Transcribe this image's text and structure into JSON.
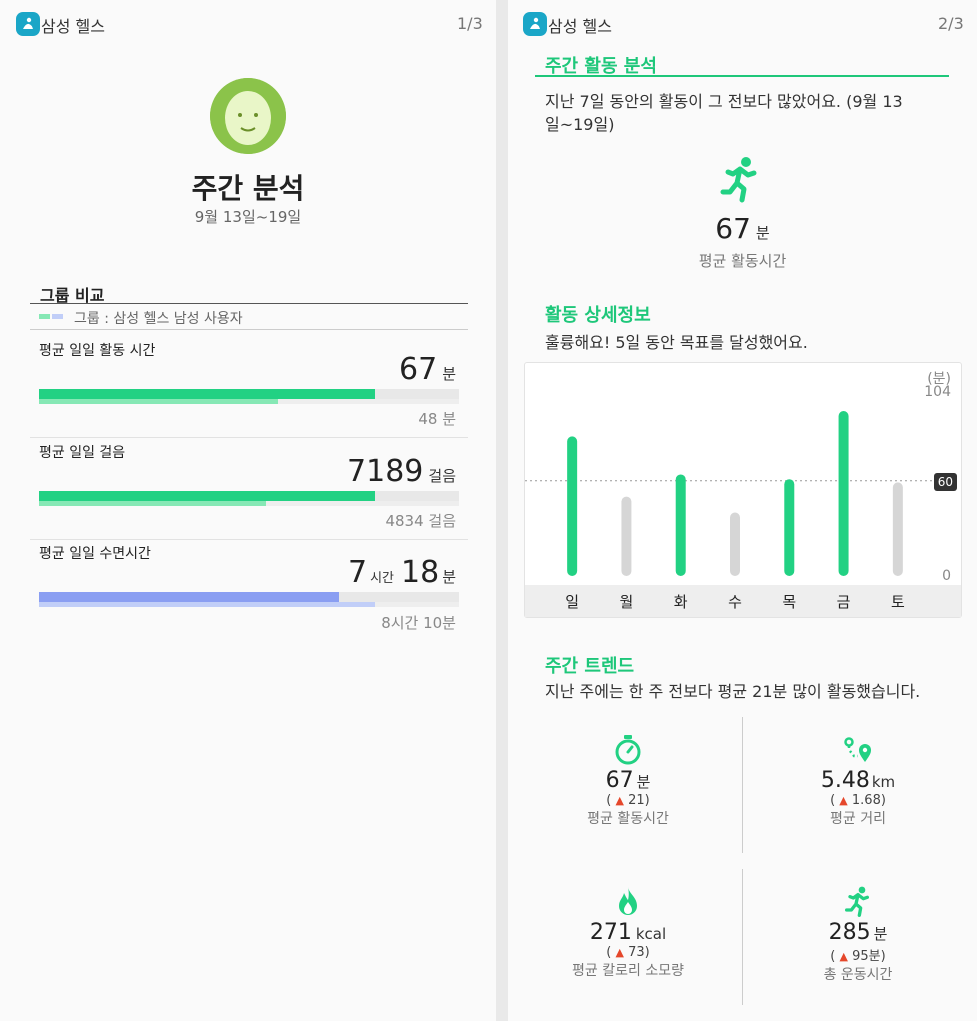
{
  "app": {
    "name": "삼성 헬스"
  },
  "page1": {
    "page_num": "1/3",
    "title": "주간 분석",
    "date_range": "9월 13일~19일",
    "group_section": {
      "title": "그룹 비교",
      "legend": "그룹 : 삼성 헬스 남성 사용자",
      "metrics": [
        {
          "label": "평균 일일 활동 시간",
          "value": "67",
          "unit": "분",
          "group_value": "48 분",
          "user_fraction": 0.8,
          "group_fraction": 0.57
        },
        {
          "label": "평균 일일 걸음",
          "value": "7189",
          "unit": "걸음",
          "group_value": "4834 걸음",
          "user_fraction": 0.8,
          "group_fraction": 0.54
        },
        {
          "label": "평균 일일 수면시간",
          "value_h": "7",
          "unit_h": "시간",
          "value_m": "18",
          "unit_m": "분",
          "group_value": "8시간 10분",
          "user_fraction": 0.715,
          "group_fraction": 0.8
        }
      ]
    }
  },
  "page2": {
    "page_num": "2/3",
    "weekly_activity": {
      "title": "주간 활동 분석",
      "description": "지난 7일 동안의 활동이 그 전보다 많았어요. (9월 13일~19일)",
      "avg_value": "67",
      "avg_unit": "분",
      "avg_label": "평균 활동시간"
    },
    "details": {
      "title": "활동 상세정보",
      "description": "훌륭해요! 5일 동안 목표를 달성했어요."
    },
    "trend": {
      "title": "주간 트렌드",
      "description": "지난 주에는 한 주 전보다 평균 21분 많이 활동했습니다.",
      "items": [
        {
          "icon": "stopwatch-icon",
          "value": "67",
          "unit": "분",
          "delta": "21",
          "label": "평균 활동시간"
        },
        {
          "icon": "route-icon",
          "value": "5.48",
          "unit": "km",
          "delta": "1.68",
          "label": "평균 거리"
        },
        {
          "icon": "flame-icon",
          "value": "271",
          "unit": "kcal",
          "delta": "73",
          "label": "평균 칼로리 소모량"
        },
        {
          "icon": "runner-icon",
          "value": "285",
          "unit": "분",
          "delta": "95분",
          "label": "총 운동시간"
        }
      ]
    }
  },
  "chart_data": {
    "type": "bar",
    "categories": [
      "일",
      "월",
      "화",
      "수",
      "목",
      "금",
      "토"
    ],
    "values": [
      88,
      50,
      64,
      40,
      61,
      104,
      59
    ],
    "goal": 60,
    "goal_label": "60",
    "unit_label": "(분)",
    "ymax_label": "104",
    "ymin_label": "0",
    "ylim": [
      0,
      104
    ],
    "colors": {
      "met": "#22d183",
      "not_met": "#d6d6d6"
    }
  }
}
